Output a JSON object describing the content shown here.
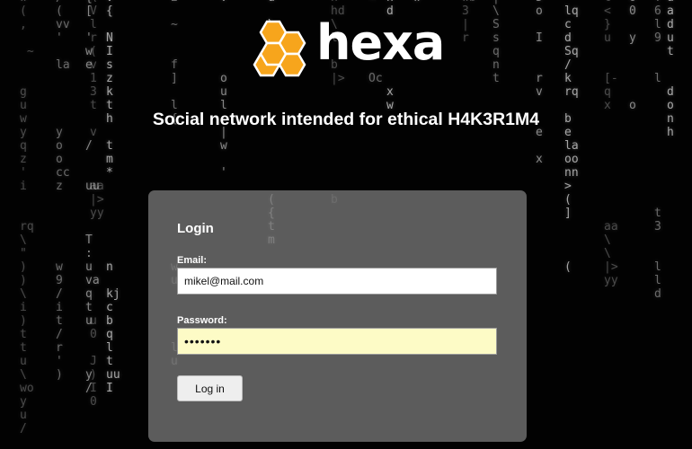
{
  "brand": {
    "name": "hexa",
    "tagline": "Social network intended for ethical H4K3R1M4",
    "logo_color": "#f7a51c"
  },
  "login": {
    "title": "Login",
    "email_label": "Email:",
    "email_value": "mikel@mail.com",
    "password_label": "Password:",
    "password_value": "•••••••",
    "submit_label": "Log in"
  },
  "colors": {
    "background": "#020202",
    "card": "#767676",
    "password_autofill": "#fdfbc6"
  },
  "matrix_columns": [
    "w\n(\n,\n\n ~\n\n\ng\nu\nw\ny\nq\nz\n'\ni\n\n\nrq\n\\\n\"\n)\n)\n\\\ni\n)\nt\nt\nu\n\\\nwo\ny\nu\n/",
    "/\n(\nvv\n'\n\nla\n\n\n\n\ny\no\no\ncc\nz\n\n\n\n\n\nw\n9\n/\ni\nt\n/\nr\n'\n)",
    "{\n[\n\n'\nw\ne\n\n\n\n\n\n/\n\n\nuu\n\n\n\nT\n:\nu\nva\nq\nt\nu\n\n\n\ny\n/",
    "v\n{\n\nN\nI\ns\nz\nk\nt\nh\n\nt\nm\n*\n\n\n\n\n\n\nn\n\nkj\nc\nb\nq\nl\nt\nuu\nI",
    "\\\nV\nl\nr\n(\nv\n1\n3\nt\n\nv\n\n\n\naa\n|>\nyy\n\n\n \n\n\n\n\nu\n0\n \nJ\n)\nI\n0",
    "2\n\n~\n\n\nf\n]\n\nl\n{\n\n\n\n\n\n\n\n\n\n\nw\nua\n\n\n\n\nla\nu\n\n",
    "v\n\n\n\n\n\no\nu\nl\n\n|\nw\n\n'\n\n\n\n\n\n\n\n\n\n\n\n\n\n\n\nuu\n\n\n",
    "u\n\n\\\n(\n\n\n\n\n\n\n\n\n\n\n\n(\n{\nt\nm\n\n\n\n\n\n\n\n\n\n\n\n",
    "h\nhd\n\\\nl\n\nb\n|>\n\n\n\n\n\n\n\n\nb\n\n\n\n\n\n\n\n\n\n\n\n\n\n\n",
    "<\n\n\n\n\n\nOc\n\n\n\n\n\n\n\n\n\n\n\n\n\n\n\n\n\n\n\n\n\n\n\n",
    "w\n\n\n\n\n\n\n\n\n\n\n\n\n\n\n\n\n\n\n\n\n\n\n\n\n\n\n\n\n\n",
    "h\nd\n\n(\n\n\n\nx\nw\n\n\n\n\n\n\n\n\n\n\n\n\n\n\n\n\n\n\n\n\n",
    "wb\n3\n|\nr\n\n\n\n\n\n\n\n\n\n\n\n\n\n\n\n\n\n\n\n\n\n\n\n\n",
    "|\n\\\nS\ns\nq\nn\nt\n\n\n\n\n\n\n\n\n\n\n\n\n\n\n\n\n\n\n\n\n",
    "5\no\n\nI\n\n\nr\nv\n\n\ne\n\nx\n\n\n\n\n\n\n\n\n\n\n\n\n\n\n",
    "\nlq\nc\nd\nSq\n/\nk\nrq\n\nb\ne\nla\noo\nnn\n>\n(\n]\n\n\n\n(\n\n\n\n\n\n",
    "t\n<\n}\nu\n\n\n[-\nq\nx\n\n\n\n\n\n\n\n\naa\n\\\n\\\n|>\nyy\n\n\n\n\n\n",
    "Y\n6\nl\n9\n\n\nl\n\n\n\n\n\n\n\n\n\nt\n3\n\n\nl\nl\nd\n\n\n\n",
    "o\n0\n\ny\n\n\n\n\no\n\n\n\n\n\n\n\n\n\n\n\n\n\n\n\n\n\n",
    "u\na\nd\nu\nt\n\n\nd\no\nn\nh\n\n\n\n\n\n\n\n\n\n\n\n\n\n\n"
  ]
}
